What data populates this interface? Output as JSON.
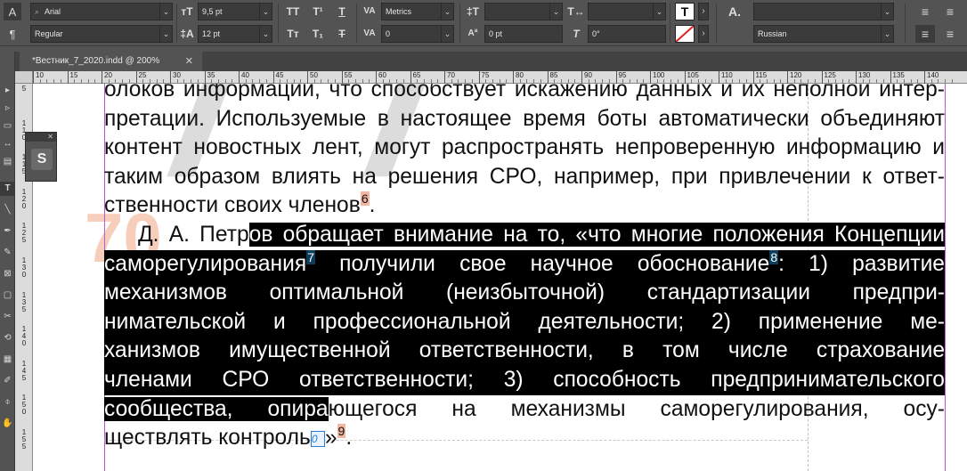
{
  "control_panel": {
    "font_family": "Arial",
    "font_style": "Regular",
    "font_size": "9,5 pt",
    "leading": "12 pt",
    "kerning": "Metrics",
    "tracking": "0",
    "baseline_shift": "0 pt",
    "skew": "0°",
    "language": "Russian",
    "char_style_buttons": {
      "all_caps": "TT",
      "superscript": "T¹",
      "underline": "T",
      "small_caps": "Tт",
      "subscript": "T₁",
      "strikethrough": "T"
    },
    "mode_icons": {
      "character": "A",
      "paragraph": "¶"
    },
    "para_icons": {
      "character_style": "A."
    }
  },
  "document_tab": {
    "title": "*Вестник_7_2020.indd @ 200%",
    "close": "✕"
  },
  "horizontal_ruler": [
    "10",
    "15",
    "20",
    "25",
    "30",
    "35",
    "40",
    "45",
    "50",
    "55",
    "60",
    "65",
    "70",
    "75",
    "80",
    "85",
    "90",
    "95",
    "100",
    "105",
    "110",
    "115",
    "120",
    "125",
    "130",
    "135",
    "140"
  ],
  "vertical_ruler": [
    "5",
    "1 1 0",
    "1 1 5",
    "1 2 0",
    "1 2 5",
    "1 3 0",
    "1 3 5",
    "1 4 0",
    "1 4 5",
    "1 5 0",
    "1 5 5"
  ],
  "body_text": {
    "line1": "олоков информации, что способствует искажению данных и их неполной интер-",
    "line2": "претации. Используемые в настоящее время боты автоматически объединяют",
    "line3": "контент новостных лент, могут распространять непроверенную информацию и",
    "line4": "таким образом влиять на решения СРО, например, при привлечении к ответ-",
    "line5a": "ственности своих членов",
    "line5_fn": "6",
    "line5b": ".",
    "line6a": "Д. А. Петр",
    "line6b": "ов обращает внимание на то, «что многие положения Концепции",
    "line7a": "саморегулирования",
    "line7_fn": "7",
    "line7b": " получили свое научное обоснование",
    "line7_fn2": "8",
    "line7c": ": 1) развитие",
    "line8": "механизмов оптимальной (неизбыточной) стандартизации предпри-",
    "line9": "нимательской и профессиональной деятельности; 2) применение ме-",
    "line10": "ханизмов имущественной ответственности, в том числе страхование",
    "line11": "членами СРО ответственности; 3) способность предпринимательского",
    "line12a": "сообщества, опира",
    "line12b": "ющегося на механизмы саморегулирования, осу-",
    "line13a": "ществлять контроль",
    "line13_anchor": "0",
    "line13b": "»",
    "line13_fn": "9",
    "line13c": "."
  },
  "floating_panel": {
    "button_glyph": "S"
  },
  "colors": {
    "ui_bg": "#535353",
    "selection": "#000000",
    "footnote_marker": "#f3b6a1",
    "guide": "#b95bd0"
  }
}
